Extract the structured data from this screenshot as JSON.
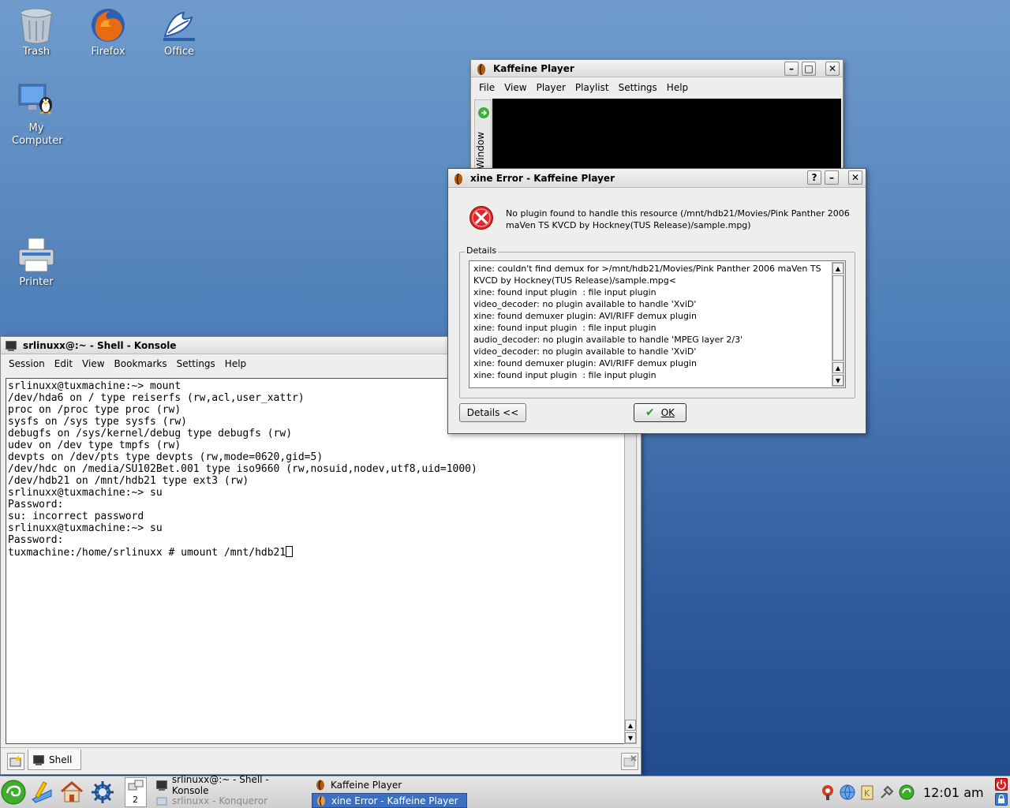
{
  "desktop": {
    "icons": [
      {
        "label": "Trash"
      },
      {
        "label": "Firefox"
      },
      {
        "label": "Office"
      },
      {
        "label": "My Computer"
      },
      {
        "label": "Printer"
      }
    ]
  },
  "konsole": {
    "title": "srlinuxx@:~ - Shell - Konsole",
    "menu": [
      "Session",
      "Edit",
      "View",
      "Bookmarks",
      "Settings",
      "Help"
    ],
    "lines": [
      "srlinuxx@tuxmachine:~> mount",
      "/dev/hda6 on / type reiserfs (rw,acl,user_xattr)",
      "proc on /proc type proc (rw)",
      "sysfs on /sys type sysfs (rw)",
      "debugfs on /sys/kernel/debug type debugfs (rw)",
      "udev on /dev type tmpfs (rw)",
      "devpts on /dev/pts type devpts (rw,mode=0620,gid=5)",
      "/dev/hdc on /media/SU102Bet.001 type iso9660 (rw,nosuid,nodev,utf8,uid=1000)",
      "/dev/hdb21 on /mnt/hdb21 type ext3 (rw)",
      "srlinuxx@tuxmachine:~> su",
      "Password:",
      "su: incorrect password",
      "srlinuxx@tuxmachine:~> su",
      "Password:"
    ],
    "prompt_line": "tuxmachine:/home/srlinuxx # umount /mnt/hdb21",
    "tab_label": "Shell"
  },
  "kaffeine": {
    "title": "Kaffeine Player",
    "menu": [
      "File",
      "View",
      "Player",
      "Playlist",
      "Settings",
      "Help"
    ],
    "side_tab": "Window"
  },
  "error_dialog": {
    "title": "xine Error - Kaffeine Player",
    "message": "No plugin found to handle this resource (/mnt/hdb21/Movies/Pink Panther 2006 maVen TS KVCD by Hockney(TUS Release)/sample.mpg)",
    "details_label": "Details",
    "details_lines": [
      "xine: couldn't find demux for >/mnt/hdb21/Movies/Pink Panther 2006 maVen TS",
      "KVCD by Hockney(TUS Release)/sample.mpg<",
      "xine: found input plugin  : file input plugin",
      "video_decoder: no plugin available to handle 'XviD'",
      "xine: found demuxer plugin: AVI/RIFF demux plugin",
      "xine: found input plugin  : file input plugin",
      "audio_decoder: no plugin available to handle 'MPEG layer 2/3'",
      "video_decoder: no plugin available to handle 'XviD'",
      "xine: found demuxer plugin: AVI/RIFF demux plugin",
      "xine: found input plugin  : file input plugin"
    ],
    "details_button": "Details <<",
    "ok_button": "OK"
  },
  "taskbar": {
    "desktop_number": "2",
    "tasks": [
      {
        "label": "srlinuxx@:~ - Shell - Konsole"
      },
      {
        "label": "srlinuxx - Konqueror"
      },
      {
        "label": "Kaffeine Player"
      },
      {
        "label": "xine Error - Kaffeine Player"
      }
    ],
    "clock": "12:01 am"
  }
}
